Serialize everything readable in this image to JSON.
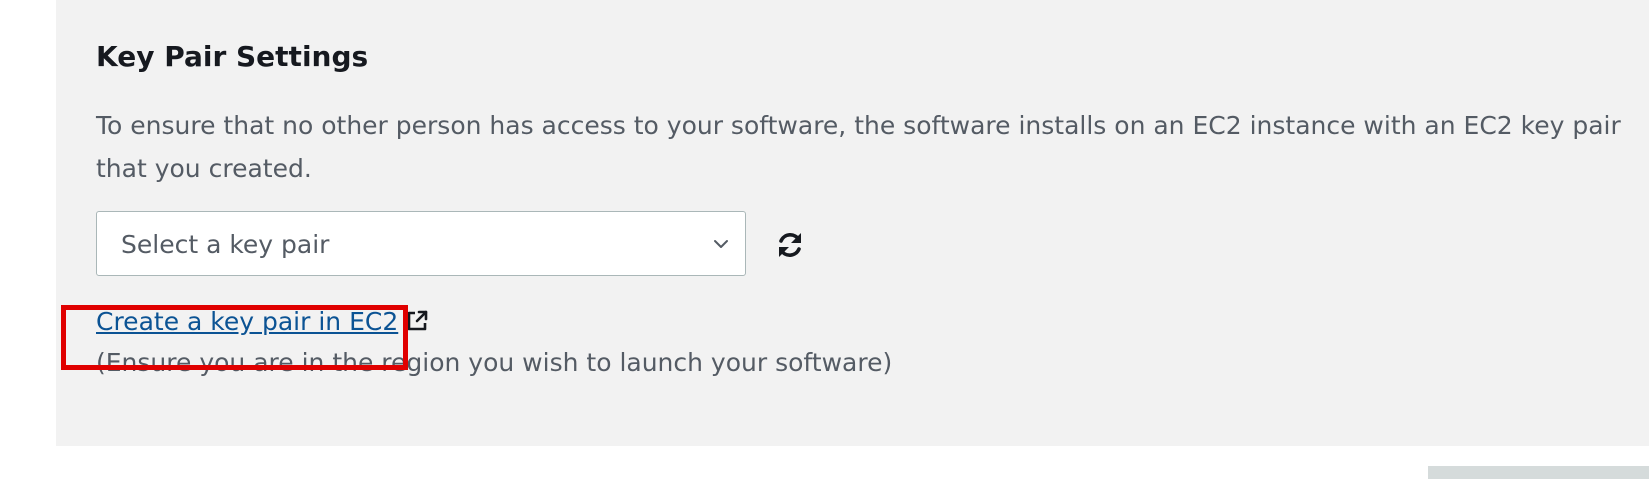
{
  "section": {
    "title": "Key Pair Settings",
    "description": "To ensure that no other person has access to your software, the software installs on an EC2 instance with an EC2 key pair that you created."
  },
  "key_pair_select": {
    "placeholder": "Select a key pair",
    "icon": "chevron-down-icon"
  },
  "refresh": {
    "icon": "refresh-icon"
  },
  "create_link": {
    "label": "Create a key pair in EC2",
    "icon": "external-link-icon"
  },
  "note": "(Ensure you are in the region you wish to launch your software)",
  "colors": {
    "panel_bg": "#f2f2f2",
    "link": "#0b5394",
    "highlight": "#e00000",
    "text_secondary": "#545b64",
    "heading": "#16191f"
  }
}
